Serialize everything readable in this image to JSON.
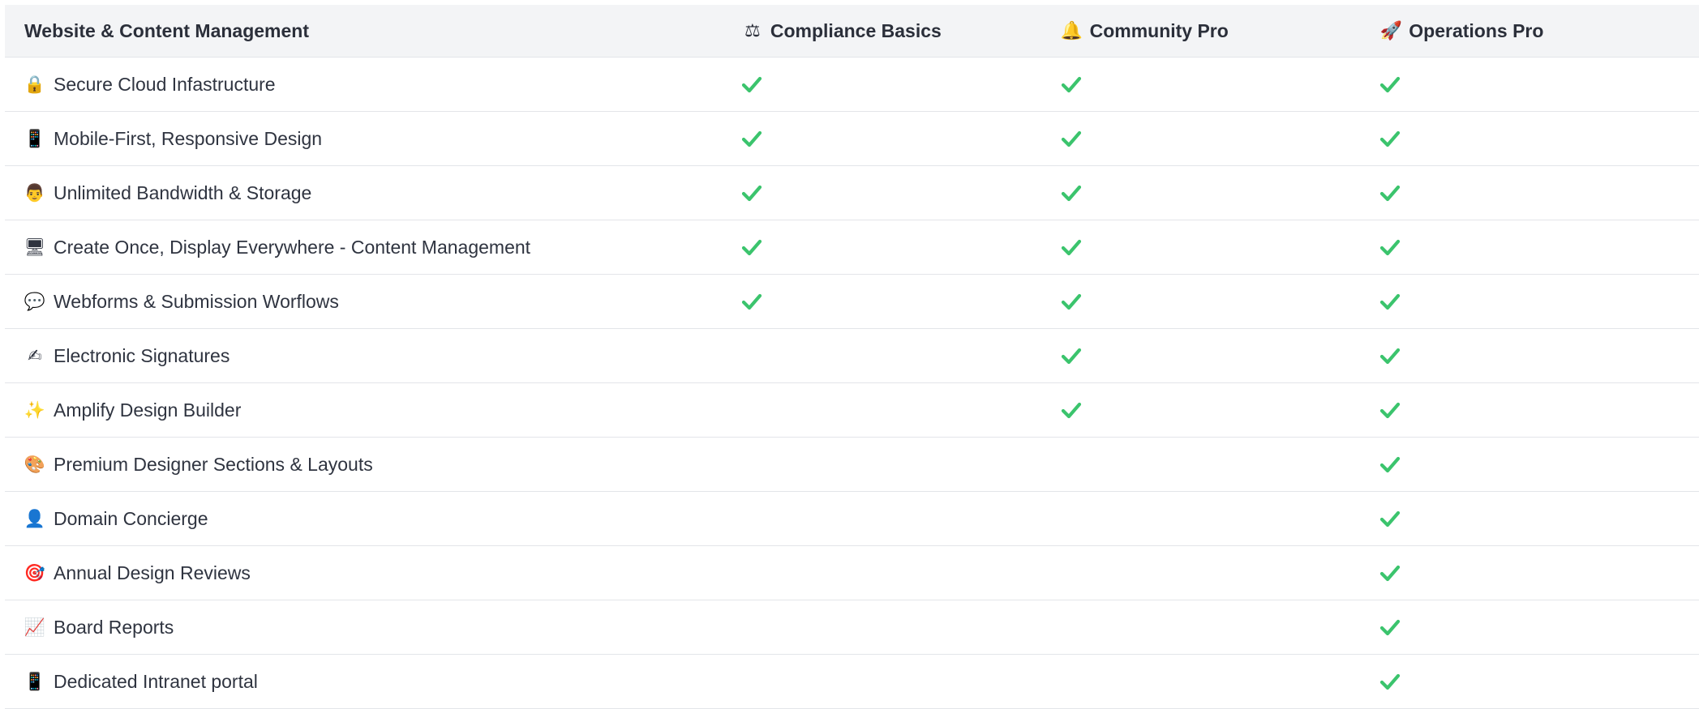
{
  "header": {
    "title": "Website & Content Management",
    "plans": [
      {
        "name": "Compliance Basics",
        "icon": "balance-scale-icon",
        "glyph": "⚖"
      },
      {
        "name": "Community Pro",
        "icon": "bell-icon",
        "glyph": "🔔"
      },
      {
        "name": "Operations Pro",
        "icon": "rocket-icon",
        "glyph": "🚀"
      }
    ]
  },
  "check_color": "#3bc46d",
  "features": [
    {
      "label": "Secure Cloud Infastructure",
      "icon": "lock-icon",
      "glyph": "🔒",
      "included": [
        true,
        true,
        true
      ]
    },
    {
      "label": "Mobile-First, Responsive Design",
      "icon": "mobile-phone-icon",
      "glyph": "📱",
      "included": [
        true,
        true,
        true
      ]
    },
    {
      "label": "Unlimited Bandwidth & Storage",
      "icon": "technologist-icon",
      "glyph": "👨",
      "included": [
        true,
        true,
        true
      ]
    },
    {
      "label": "Create Once, Display Everywhere - Content Management",
      "icon": "desktop-computer-icon",
      "glyph": "🖥",
      "included": [
        true,
        true,
        true
      ]
    },
    {
      "label": "Webforms & Submission Worflows",
      "icon": "speech-bubble-icon",
      "glyph": "💬",
      "included": [
        true,
        true,
        true
      ]
    },
    {
      "label": "Electronic Signatures",
      "icon": "writing-hand-icon",
      "glyph": "✍",
      "included": [
        false,
        true,
        true
      ]
    },
    {
      "label": "Amplify Design Builder",
      "icon": "magic-wand-icon",
      "glyph": "✨",
      "included": [
        false,
        true,
        true
      ]
    },
    {
      "label": "Premium Designer Sections & Layouts",
      "icon": "artist-palette-icon",
      "glyph": "🎨",
      "included": [
        false,
        false,
        true
      ]
    },
    {
      "label": "Domain Concierge",
      "icon": "concierge-person-icon",
      "glyph": "👤",
      "included": [
        false,
        false,
        true
      ]
    },
    {
      "label": "Annual Design Reviews",
      "icon": "direct-hit-target-icon",
      "glyph": "🎯",
      "included": [
        false,
        false,
        true
      ]
    },
    {
      "label": "Board Reports",
      "icon": "chart-increasing-icon",
      "glyph": "📈",
      "included": [
        false,
        false,
        true
      ]
    },
    {
      "label": "Dedicated Intranet portal",
      "icon": "smartphone-icon",
      "glyph": "📱",
      "included": [
        false,
        false,
        true
      ]
    }
  ]
}
